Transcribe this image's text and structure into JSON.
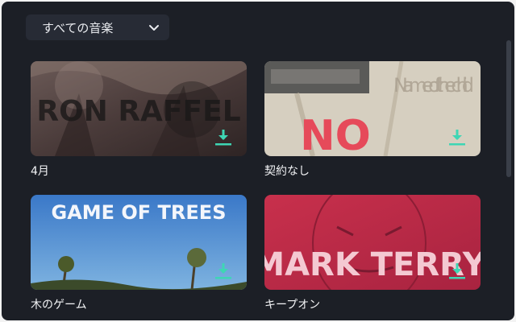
{
  "filter": {
    "label": "すべての音楽",
    "icon": "chevron-down-icon"
  },
  "tracks": [
    {
      "title": "4月",
      "art_text": "RON RAFFEL",
      "icon": "download-icon"
    },
    {
      "title": "契約なし",
      "art_text": "NO",
      "art_text_secondary": "Name of the child",
      "icon": "download-icon"
    },
    {
      "title": "木のゲーム",
      "art_text": "GAME OF TREES",
      "icon": "download-icon"
    },
    {
      "title": "キープオン",
      "art_text": "MARK TERRY",
      "icon": "download-icon"
    }
  ],
  "colors": {
    "panel": "#1c1f26",
    "accent": "#3ed6b4",
    "text": "#f2f3f5"
  }
}
